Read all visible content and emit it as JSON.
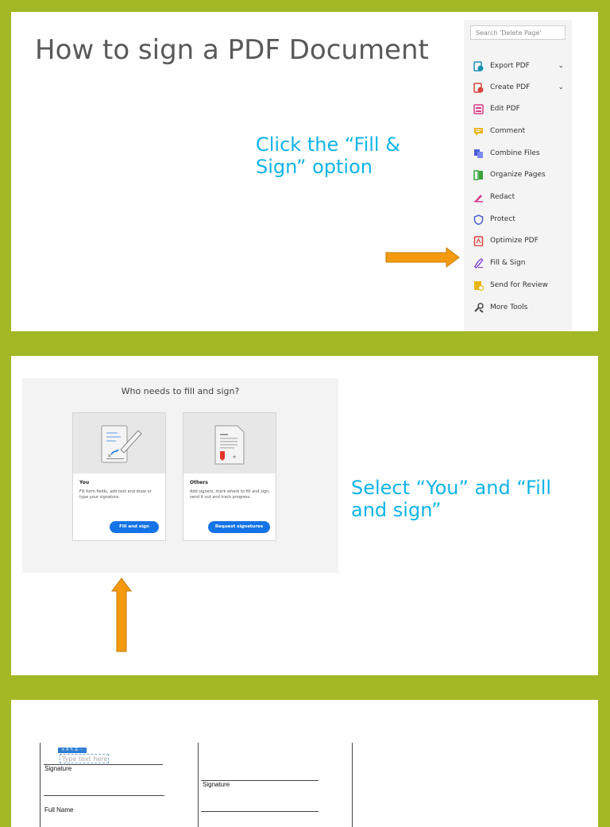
{
  "slide1": {
    "title": "How to sign a PDF Document",
    "callout": "Click the “Fill & Sign” option",
    "tools_panel": {
      "search_placeholder": "Search 'Delete Page'",
      "items": [
        {
          "label": "Export PDF",
          "icon": "export-pdf-icon",
          "has_chevron": true
        },
        {
          "label": "Create PDF",
          "icon": "create-pdf-icon",
          "has_chevron": true
        },
        {
          "label": "Edit PDF",
          "icon": "edit-pdf-icon"
        },
        {
          "label": "Comment",
          "icon": "comment-icon"
        },
        {
          "label": "Combine Files",
          "icon": "combine-files-icon"
        },
        {
          "label": "Organize Pages",
          "icon": "organize-pages-icon"
        },
        {
          "label": "Redact",
          "icon": "redact-icon"
        },
        {
          "label": "Protect",
          "icon": "protect-icon"
        },
        {
          "label": "Optimize PDF",
          "icon": "optimize-pdf-icon"
        },
        {
          "label": "Fill & Sign",
          "icon": "fill-sign-icon"
        },
        {
          "label": "Send for Review",
          "icon": "send-for-review-icon"
        },
        {
          "label": "More Tools",
          "icon": "more-tools-icon"
        }
      ],
      "chevron": "⌄"
    }
  },
  "slide2": {
    "callout": "Select “You” and “Fill and sign”",
    "dialog": {
      "title": "Who needs to fill and sign?",
      "you_card": {
        "title": "You",
        "description": "Fill form fields, add text and draw or type your signature.",
        "button": "Fill and sign"
      },
      "others_card": {
        "title": "Others",
        "description": "Add signers, mark where to fill and sign, send it out and track progress.",
        "button": "Request signatures"
      }
    }
  },
  "slide3": {
    "toolbar_text": "× A ✎ ☰ ···",
    "textbox_placeholder": "Type text here",
    "signature_label_left": "Signature",
    "signature_label_right": "Signature",
    "full_name_label": "Full Name"
  },
  "colors": {
    "background": "#a3b825",
    "callout": "#0fb4e8",
    "arrow": "#f59a0f",
    "button": "#1473e6"
  }
}
